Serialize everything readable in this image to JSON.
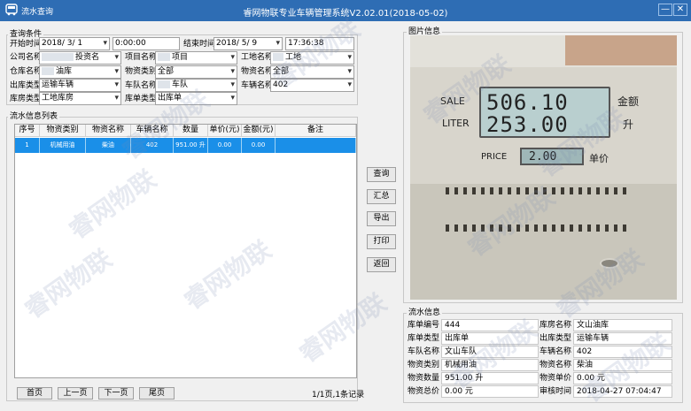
{
  "window": {
    "title": "流水查询",
    "app_title": "睿网物联专业车辆管理系统V2.02.01(2018-05-02)",
    "minimize": "—",
    "close": "✕"
  },
  "query": {
    "group_title": "查询条件",
    "start_time_label": "开始时间",
    "start_date": "2018/ 3/ 1",
    "start_time": "0:00:00",
    "end_time_label": "结束时间",
    "end_date": "2018/ 5/ 9",
    "end_time": "17:36:38",
    "company_label": "公司名称",
    "company_value": "投资名",
    "project_label": "项目名称",
    "project_value": "项目",
    "site_label": "工地名称",
    "site_value": "工地",
    "warehouse_label": "仓库名称",
    "warehouse_value": "油库",
    "material_type_label": "物资类别",
    "material_type_value": "全部",
    "material_name_label": "物资名称",
    "material_name_value": "全部",
    "out_type_label": "出库类型",
    "out_type_value": "运输车辆",
    "team_label": "车队名称",
    "team_value": "车队",
    "vehicle_label": "车辆名称",
    "vehicle_value": "402",
    "room_type_label": "库房类型",
    "room_type_value": "工地库房",
    "bill_type_label": "库单类型",
    "bill_type_value": "出库单"
  },
  "list": {
    "group_title": "流水信息列表",
    "columns": [
      "序号",
      "物资类别",
      "物资名称",
      "车辆名称",
      "数量",
      "单价(元)",
      "金额(元)",
      "备注"
    ],
    "rows": [
      [
        "1",
        "机械用油",
        "柴油",
        "402",
        "951.00 升",
        "0.00",
        "0.00",
        ""
      ]
    ],
    "pager": {
      "first": "首页",
      "prev": "上一页",
      "next": "下一页",
      "last": "尾页",
      "info": "1/1页,1条记录"
    }
  },
  "actions": {
    "query": "查询",
    "summary": "汇总",
    "export": "导出",
    "print": "打印",
    "back": "返回"
  },
  "image": {
    "group_title": "图片信息",
    "sale_label": "SALE",
    "sale_value": "506.10",
    "sale_unit": "金额",
    "liter_label": "LITER",
    "liter_value": "253.00",
    "liter_unit": "升",
    "price_label": "PRICE",
    "price_value": "2.00",
    "price_unit": "单价"
  },
  "detail": {
    "group_title": "流水信息",
    "bill_no_label": "库单编号",
    "bill_no": "444",
    "room_name_label": "库房名称",
    "room_name": "文山油库",
    "bill_type_label": "库单类型",
    "bill_type": "出库单",
    "out_type_label": "出库类型",
    "out_type": "运输车辆",
    "team_label": "车队名称",
    "team": "文山车队",
    "vehicle_label": "车辆名称",
    "vehicle": "402",
    "mat_type_label": "物资类别",
    "mat_type": "机械用油",
    "mat_name_label": "物资名称",
    "mat_name": "柴油",
    "qty_label": "物资数量",
    "qty": "951.00 升",
    "unit_price_label": "物资单价",
    "unit_price": "0.00 元",
    "total_label": "物资总价",
    "total": "0.00 元",
    "audit_time_label": "审核时间",
    "audit_time": "2018-04-27 07:04:47"
  },
  "watermark": "睿网物联",
  "colors": {
    "titlebar": "#2e6db4",
    "selected_row": "#1a8fe8"
  }
}
